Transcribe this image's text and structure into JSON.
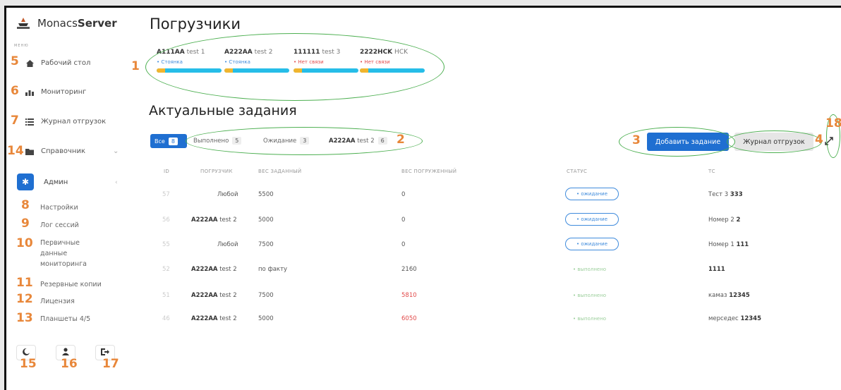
{
  "sidebar": {
    "app_name_light": "Monacs",
    "app_name_bold": "Server",
    "menu_caption": "МЕНЮ",
    "items": [
      {
        "label": "Рабочий стол",
        "icon": "home-icon"
      },
      {
        "label": "Мониторинг",
        "icon": "chart-icon"
      },
      {
        "label": "Журнал отгрузок",
        "icon": "list-icon"
      },
      {
        "label": "Справочник",
        "icon": "folder-icon"
      }
    ],
    "admin": {
      "label": "Админ",
      "icon": "gear-icon",
      "sub_items": [
        {
          "label": "Настройки"
        },
        {
          "label": "Лог сессий"
        },
        {
          "label": "Первичные данные мониторинга"
        },
        {
          "label": "Резервные копии"
        },
        {
          "label": "Лицензия"
        },
        {
          "label": "Планшеты 4/5"
        }
      ]
    },
    "bottom_buttons": [
      {
        "icon": "moon-icon"
      },
      {
        "icon": "user-icon"
      },
      {
        "icon": "logout-icon"
      }
    ]
  },
  "loaders_section": {
    "title": "Погрузчики",
    "loaders": [
      {
        "code": "A111AA",
        "name": "test 1",
        "status": "• Стоянка",
        "status_color": "#3f8bdc"
      },
      {
        "code": "A222AA",
        "name": "test 2",
        "status": "• Стоянка",
        "status_color": "#3f8bdc"
      },
      {
        "code": "111111",
        "name": "test 3",
        "status": "• Нет связи",
        "status_color": "#e24b4b"
      },
      {
        "code": "2222HCK",
        "name": "HCK",
        "status": "• Нет связи",
        "status_color": "#e24b4b"
      }
    ]
  },
  "tasks_section": {
    "title": "Актуальные задания",
    "filters": {
      "all": {
        "label": "Все",
        "count": "8"
      },
      "done": {
        "label": "Выполнено",
        "count": "5"
      },
      "waiting": {
        "label": "Ожидание",
        "count": "3"
      },
      "loader": {
        "code": "A222AA",
        "name": "test 2",
        "count": "6"
      }
    },
    "add_button": "Добавить задание",
    "journal_button": "Журнал отгрузок",
    "columns": [
      "ID",
      "ПОГРУЗЧИК",
      "ВЕС ЗАДАННЫЙ",
      "ВЕС ПОГРУЖЕННЫЙ",
      "СТАТУС",
      "ТС"
    ],
    "rows": [
      {
        "id": "57",
        "loader_code": "",
        "loader_name": "Любой",
        "weight_set": "5500",
        "weight_loaded": "0",
        "status": "• ожидание",
        "ts_name": "Тест 3",
        "ts_num": "333"
      },
      {
        "id": "56",
        "loader_code": "A222AA",
        "loader_name": "test 2",
        "weight_set": "5000",
        "weight_loaded": "0",
        "status": "• ожидание",
        "ts_name": "Номер 2",
        "ts_num": "2"
      },
      {
        "id": "55",
        "loader_code": "",
        "loader_name": "Любой",
        "weight_set": "7500",
        "weight_loaded": "0",
        "status": "• ожидание",
        "ts_name": "Номер 1",
        "ts_num": "111"
      },
      {
        "id": "52",
        "loader_code": "A222AA",
        "loader_name": "test 2",
        "weight_set": "по факту",
        "weight_loaded": "2160",
        "status": "• выполнено",
        "ts_name": "",
        "ts_num": "1111"
      },
      {
        "id": "51",
        "loader_code": "A222AA",
        "loader_name": "test 2",
        "weight_set": "7500",
        "weight_loaded": "5810",
        "status": "• выполнено",
        "ts_name": "камаз",
        "ts_num": "12345"
      },
      {
        "id": "46",
        "loader_code": "A222AA",
        "loader_name": "test 2",
        "weight_set": "5000",
        "weight_loaded": "6050",
        "status": "• выполнено",
        "ts_name": "мерседес",
        "ts_num": "12345"
      }
    ]
  },
  "annotations": [
    "1",
    "2",
    "3",
    "4",
    "5",
    "6",
    "7",
    "8",
    "9",
    "10",
    "11",
    "12",
    "13",
    "14",
    "15",
    "16",
    "17",
    "18"
  ]
}
